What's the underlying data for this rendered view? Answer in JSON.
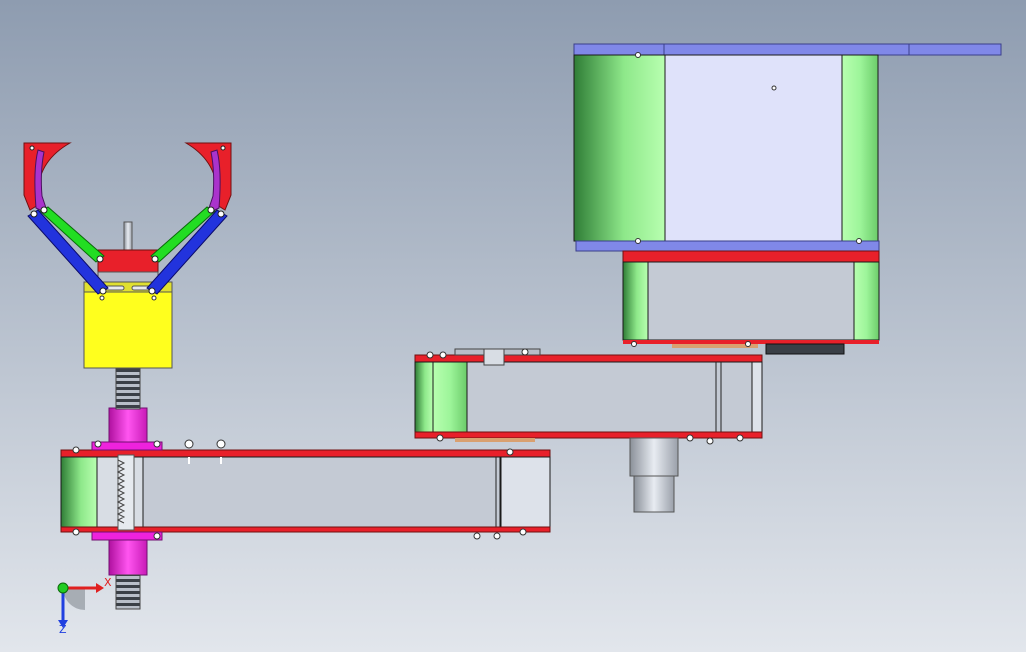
{
  "viewport": {
    "background_top": "#8e9cb0",
    "background_bottom": "#e2e6ec"
  },
  "colors": {
    "red": "#e8202a",
    "green_light": "#a8f5a0",
    "green_dark": "#3f9a47",
    "gray_panel": "#c4cad4",
    "gray_light": "#d8dde4",
    "lavender": "#dfe2fa",
    "blue_plate": "#7f87e6",
    "magenta": "#ee22dd",
    "yellow": "#ffff1e",
    "purple": "#aa33cc",
    "blue_link": "#2233dd",
    "green_link": "#22dd22",
    "spring_gray": "#9aa0a8"
  },
  "triad": {
    "x_label": "X",
    "z_label": "Z",
    "y_label": "Y"
  }
}
